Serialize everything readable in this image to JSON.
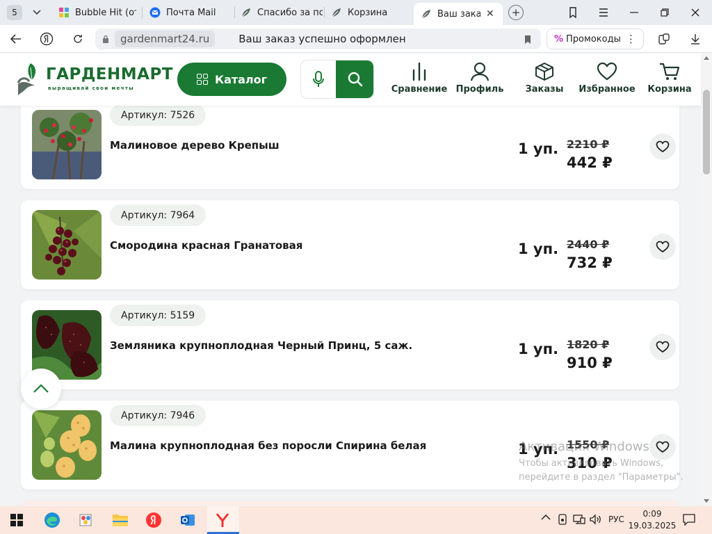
{
  "browser": {
    "tab_count": "5",
    "tabs": [
      {
        "title": "Bubble Hit (от",
        "icon": "bubble-hit-icon"
      },
      {
        "title": "Почта Mail",
        "icon": "mail-icon"
      },
      {
        "title": "Спасибо за по",
        "icon": "gardenmart-leaf-icon"
      },
      {
        "title": "Корзина",
        "icon": "gardenmart-leaf-icon"
      },
      {
        "title": "Ваш заказ у",
        "icon": "gardenmart-leaf-icon",
        "active": true
      }
    ],
    "domain": "gardenmart24.ru",
    "page_title": "Ваш заказ успешно оформлен",
    "promo_label": "Промокоды"
  },
  "site": {
    "logo_name": "ГАРДЕНМАРТ",
    "logo_tagline": "выращивай свои мечты",
    "catalog_label": "Каталог",
    "nav": [
      {
        "label": "Сравнение",
        "icon": "compare-icon"
      },
      {
        "label": "Профиль",
        "icon": "profile-icon"
      },
      {
        "label": "Заказы",
        "icon": "box-icon"
      },
      {
        "label": "Избранное",
        "icon": "heart-icon"
      },
      {
        "label": "Корзина",
        "icon": "cart-icon"
      }
    ]
  },
  "order_items": [
    {
      "sku": "Артикул: 7526",
      "name": "Малиновое дерево Крепыш",
      "qty": "1 уп.",
      "old_price": "2210 ₽",
      "price": "442 ₽",
      "image": "raspberry-tree-photo"
    },
    {
      "sku": "Артикул: 7964",
      "name": "Смородина красная Гранатовая",
      "qty": "1 уп.",
      "old_price": "2440 ₽",
      "price": "732 ₽",
      "image": "red-currant-photo"
    },
    {
      "sku": "Артикул: 5159",
      "name": "Земляника крупноплодная Черный Принц, 5 саж.",
      "qty": "1 уп.",
      "old_price": "1820 ₽",
      "price": "910 ₽",
      "image": "black-strawberry-photo"
    },
    {
      "sku": "Артикул: 7946",
      "name": "Малина крупноплодная без поросли Спирина белая",
      "qty": "1 уп.",
      "old_price": "1550 ₽",
      "price": "310 ₽",
      "image": "yellow-raspberry-photo"
    }
  ],
  "watermark": {
    "line1": "Активация Windows",
    "line2": "Чтобы активировать Windows,",
    "line3": "перейдите в раздел \"Параметры\"."
  },
  "taskbar": {
    "language": "РУС",
    "time": "0:09",
    "date": "19.03.2025"
  },
  "colors": {
    "brand_green": "#1a7a33",
    "taskbar_bg": "#fbe7dd"
  }
}
